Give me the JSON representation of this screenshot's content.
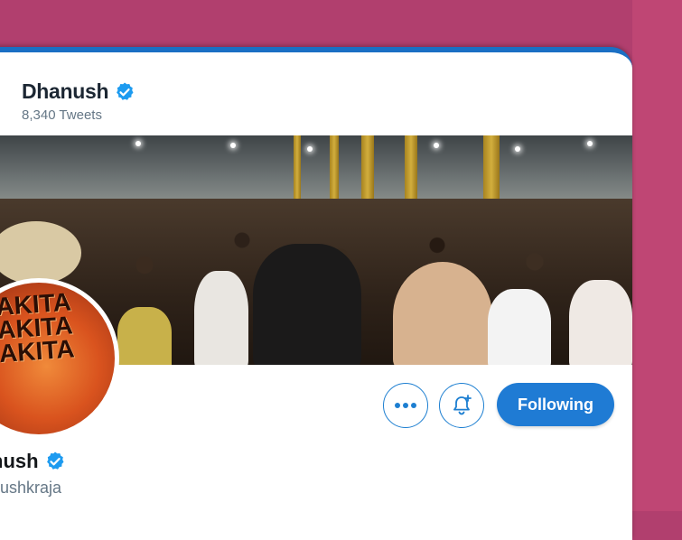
{
  "profile": {
    "display_name": "Dhanush",
    "tweet_count": "8,340 Tweets",
    "bottom_name": "nush",
    "handle": "nushkraja"
  },
  "avatar": {
    "text_lines": [
      "RAKITA",
      "RAKITA",
      "RAKITA"
    ]
  },
  "actions": {
    "more_icon": "more-dots-icon",
    "notify_icon": "bell-plus-icon",
    "follow_label": "Following"
  },
  "colors": {
    "accent": "#1f7bd4",
    "verified": "#1d9bf0",
    "background": "#b13f6e"
  }
}
